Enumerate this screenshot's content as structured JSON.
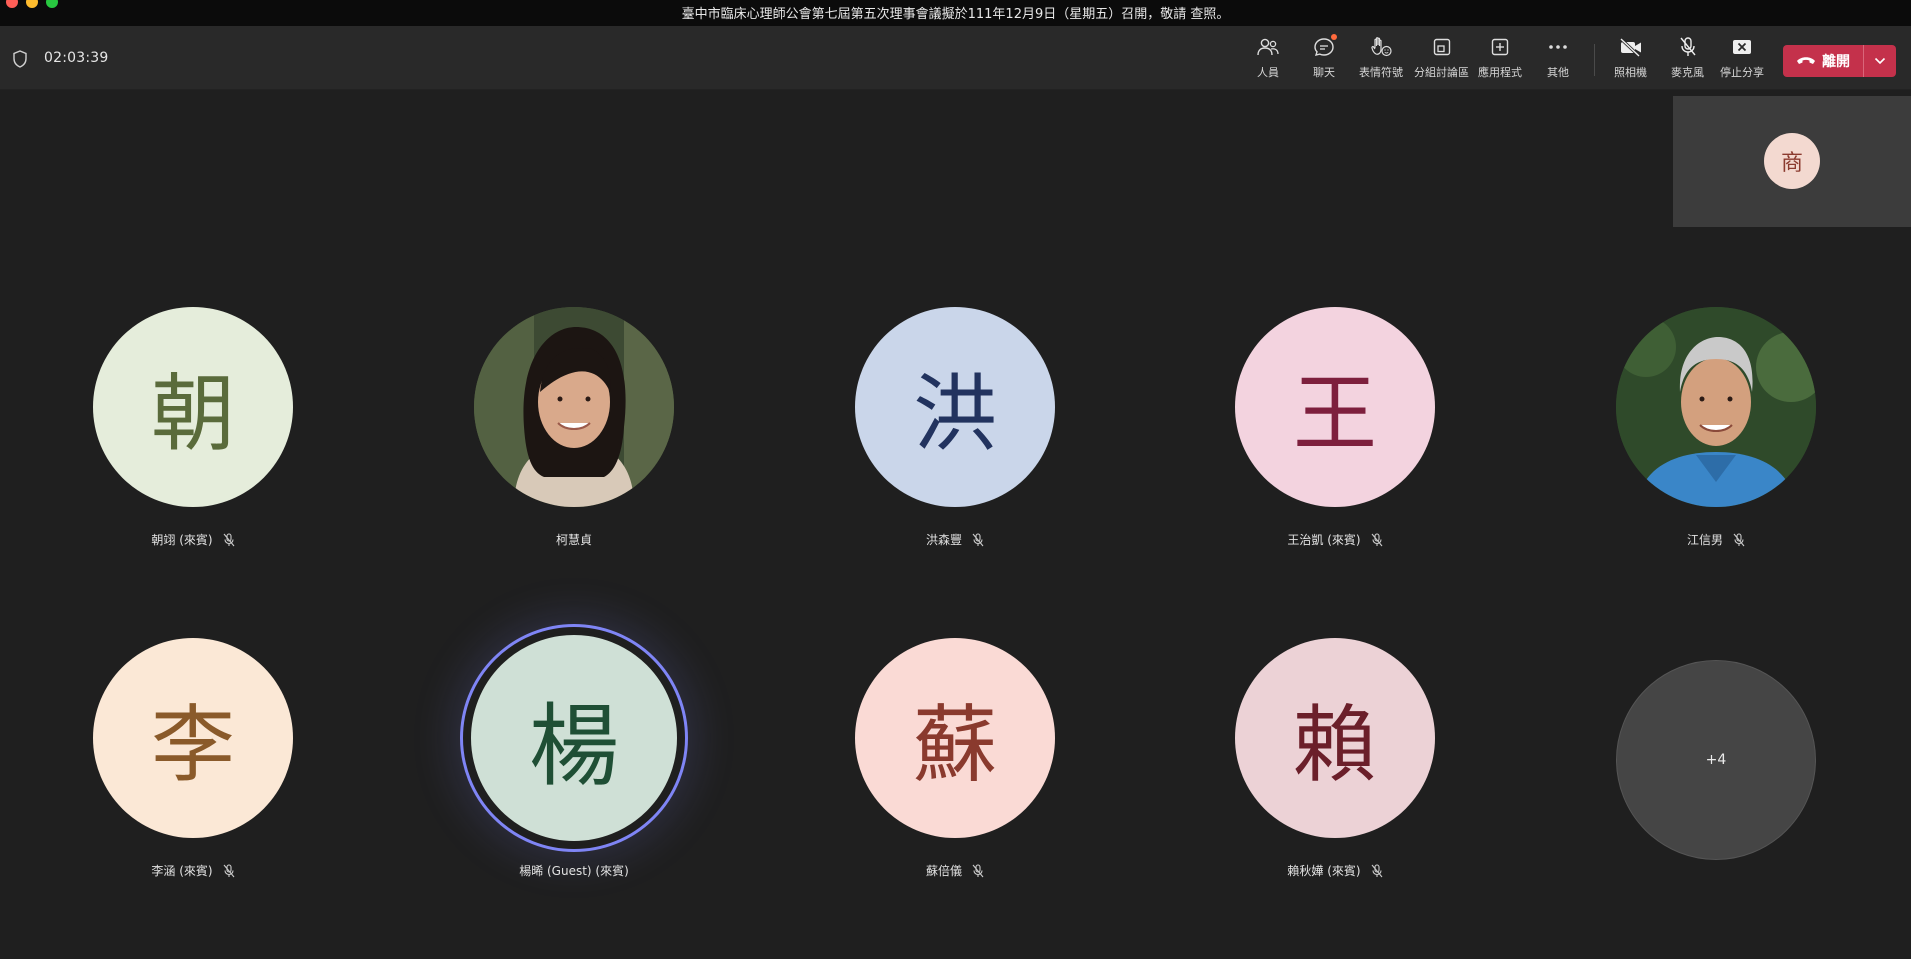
{
  "window": {
    "title": "臺中市臨床心理師公會第七屆第五次理事會議擬於111年12月9日（星期五）召開，敬請 查照。"
  },
  "meeting": {
    "elapsed": "02:03:39"
  },
  "toolbar": {
    "people": "人員",
    "chat": "聊天",
    "reactions": "表情符號",
    "rooms": "分組討論區",
    "apps": "應用程式",
    "more": "其他",
    "camera": "照相機",
    "mic": "麥克風",
    "share": "停止分享",
    "leave": "離開"
  },
  "self_view": {
    "initial": "商"
  },
  "participants": [
    {
      "initial": "朝",
      "name": "朝翊 (來賓)",
      "muted": true,
      "bg": "#e5eddb",
      "fg": "#5a6b3b"
    },
    {
      "initial": "",
      "name": "柯慧貞",
      "muted": false,
      "photo": true
    },
    {
      "initial": "洪",
      "name": "洪森豐",
      "muted": true,
      "bg": "#cad6ea",
      "fg": "#22335f"
    },
    {
      "initial": "王",
      "name": "王治凱 (來賓)",
      "muted": true,
      "bg": "#f3d3df",
      "fg": "#7d1f3d"
    },
    {
      "initial": "",
      "name": "江信男",
      "muted": true,
      "photo": true
    },
    {
      "initial": "李",
      "name": "李涵 (來賓)",
      "muted": true,
      "bg": "#fbe8d6",
      "fg": "#8a5a2a"
    },
    {
      "initial": "楊",
      "name": "楊晞 (Guest) (來賓)",
      "muted": false,
      "bg": "#cfe0d6",
      "fg": "#1f4f35",
      "speaking": true
    },
    {
      "initial": "蘇",
      "name": "蘇倍儀",
      "muted": true,
      "bg": "#fadad5",
      "fg": "#8a3a2e"
    },
    {
      "initial": "賴",
      "name": "賴秋嬅 (來賓)",
      "muted": true,
      "bg": "#ecd2d6",
      "fg": "#6b1f2a"
    }
  ],
  "overflow": {
    "label": "+4"
  }
}
